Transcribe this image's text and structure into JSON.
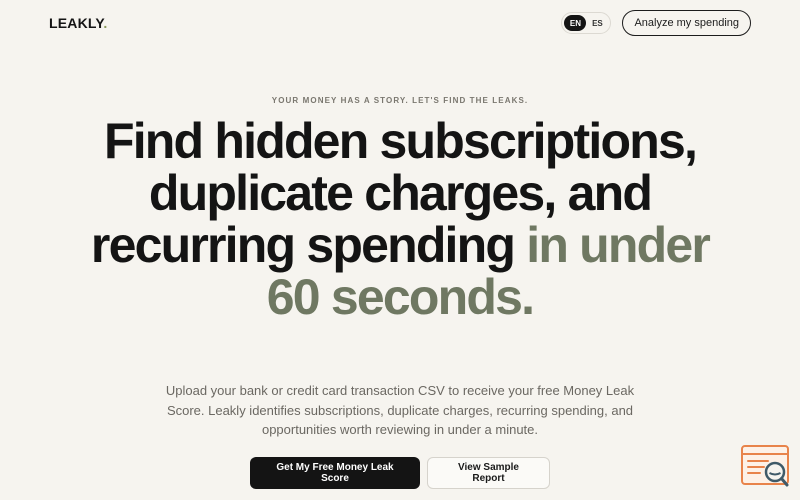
{
  "brand": {
    "name": "LEAKLY",
    "dot": "."
  },
  "header": {
    "languages": [
      "EN",
      "ES"
    ],
    "active_language": "EN",
    "analyze_label": "Analyze my spending"
  },
  "hero": {
    "eyebrow": "YOUR MONEY HAS A STORY. LET'S FIND THE LEAKS.",
    "headline_main": "Find hidden subscriptions, duplicate charges, and recurring spending",
    "headline_accent": "in under 60 seconds.",
    "subtext": "Upload your bank or credit card transaction CSV to receive your free Money Leak Score. Leakly identifies subscriptions, duplicate charges, recurring spending, and opportunities worth reviewing in under a minute."
  },
  "ctas": {
    "primary_label": "Get My Free Money Leak Score",
    "secondary_label": "View Sample Report"
  },
  "colors": {
    "background": "#f6f4ef",
    "text": "#141414",
    "accent_text": "#6f7862",
    "primary_button": "#141414",
    "widget_accent": "#e8834a"
  },
  "icons": {
    "widget": "search-report-icon"
  }
}
